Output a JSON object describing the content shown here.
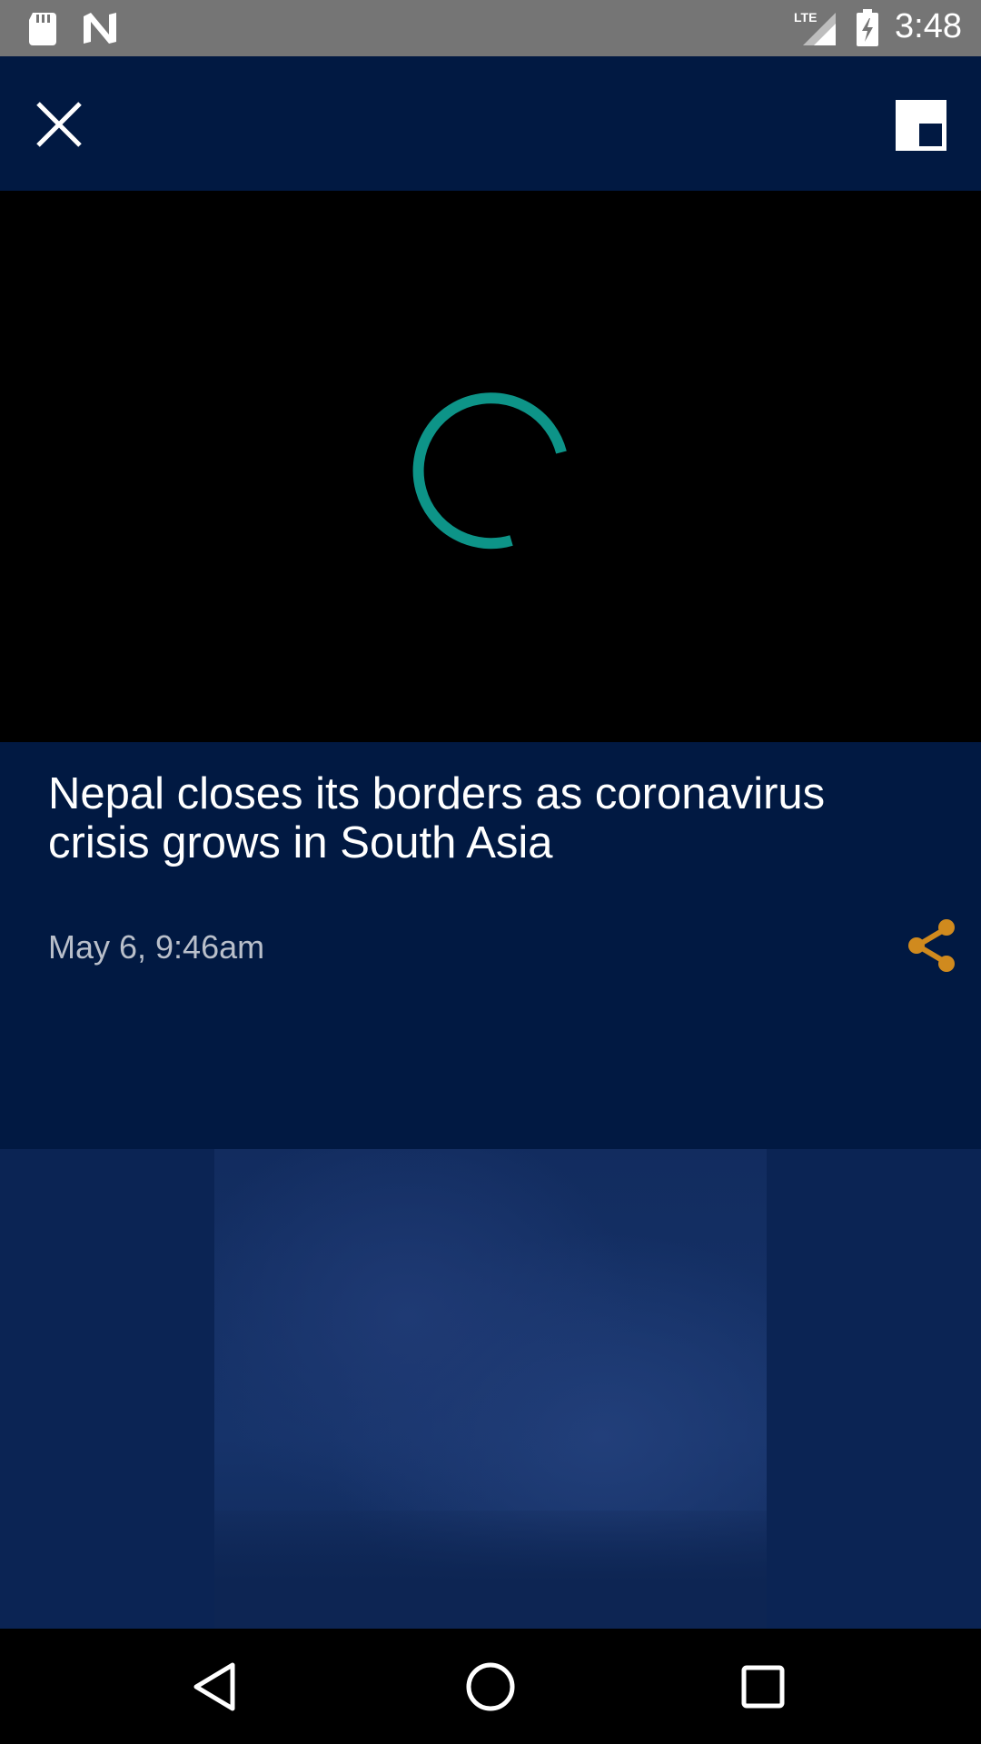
{
  "status_bar": {
    "time": "3:48",
    "network": "LTE",
    "icons": [
      "sd-card-icon",
      "n-icon",
      "lte-signal-icon",
      "battery-charging-icon"
    ]
  },
  "top_bar": {
    "icons": [
      "close-icon",
      "picture-in-picture-icon"
    ]
  },
  "video": {
    "state_icon": "loading-spinner-icon",
    "accent_color": "#0d9488"
  },
  "article": {
    "headline": "Nepal closes its borders as coronavirus crisis grows in South Asia",
    "timestamp": "May 6, 9:46am",
    "share_icon": "share-icon",
    "share_color": "#d08a1e"
  },
  "colors": {
    "background": "#011942",
    "status_bar": "#757575"
  },
  "nav_bar": {
    "icons": [
      "back-icon",
      "home-icon",
      "recent-apps-icon"
    ]
  }
}
